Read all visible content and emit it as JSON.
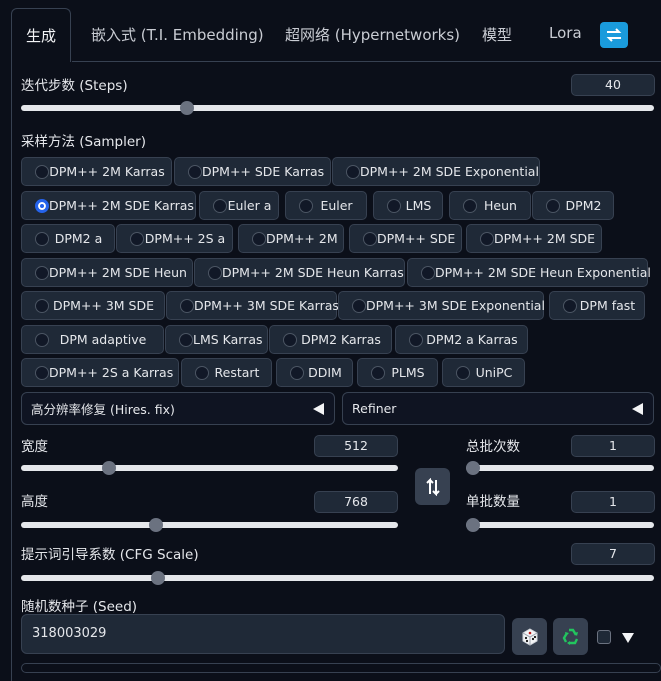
{
  "tabs": [
    {
      "label": "生成",
      "active": true
    },
    {
      "label": "嵌入式 (T.I. Embedding)"
    },
    {
      "label": "超网络 (Hypernetworks)"
    },
    {
      "label": "模型"
    },
    {
      "label": "Lora"
    }
  ],
  "refresh_icon": "refresh-icon",
  "steps": {
    "label": "迭代步数 (Steps)",
    "value": "40",
    "fraction": 0.263
  },
  "sampler": {
    "label": "采样方法 (Sampler)",
    "selected": "DPM++ 2M SDE Karras",
    "options": [
      "DPM++ 2M Karras",
      "DPM++ SDE Karras",
      "DPM++ 2M SDE Exponential",
      "DPM++ 2M SDE Karras",
      "Euler a",
      "Euler",
      "LMS",
      "Heun",
      "DPM2",
      "DPM2 a",
      "DPM++ 2S a",
      "DPM++ 2M",
      "DPM++ SDE",
      "DPM++ 2M SDE",
      "DPM++ 2M SDE Heun",
      "DPM++ 2M SDE Heun Karras",
      "DPM++ 2M SDE Heun Exponential",
      "DPM++ 3M SDE",
      "DPM++ 3M SDE Karras",
      "DPM++ 3M SDE Exponential",
      "DPM fast",
      "DPM adaptive",
      "LMS Karras",
      "DPM2 Karras",
      "DPM2 a Karras",
      "DPM++ 2S a Karras",
      "Restart",
      "DDIM",
      "PLMS",
      "UniPC"
    ]
  },
  "hires": {
    "label": "高分辨率修复 (Hires. fix)"
  },
  "refiner": {
    "label": "Refiner"
  },
  "width": {
    "label": "宽度",
    "value": "512",
    "fraction": 0.234
  },
  "height": {
    "label": "高度",
    "value": "768",
    "fraction": 0.359
  },
  "swap_icon": "swap-icon",
  "batch_count": {
    "label": "总批次数",
    "value": "1",
    "fraction": 0
  },
  "batch_size": {
    "label": "单批数量",
    "value": "1",
    "fraction": 0
  },
  "cfg": {
    "label": "提示词引导系数 (CFG Scale)",
    "value": "7",
    "fraction": 0.216
  },
  "seed": {
    "label": "随机数种子 (Seed)",
    "value": "318003029"
  },
  "dice_icon": "dice-icon",
  "recycle_icon": "recycle-icon"
}
